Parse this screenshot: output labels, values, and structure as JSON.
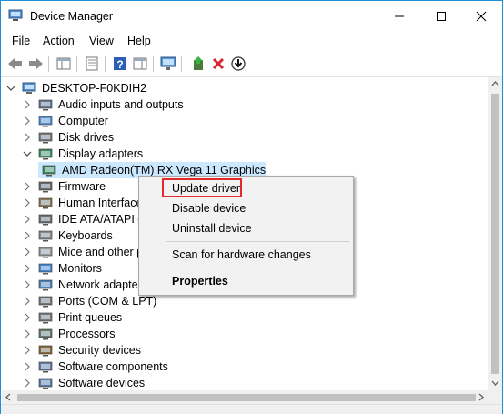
{
  "window": {
    "title": "Device Manager"
  },
  "menu": [
    "File",
    "Action",
    "View",
    "Help"
  ],
  "tree": {
    "root": "DESKTOP-F0KDIH2",
    "items": [
      {
        "label": "Audio inputs and outputs",
        "icon": "speaker-icon",
        "state": "collapsed"
      },
      {
        "label": "Computer",
        "icon": "computer-icon",
        "state": "collapsed"
      },
      {
        "label": "Disk drives",
        "icon": "disk-drive-icon",
        "state": "collapsed"
      },
      {
        "label": "Display adapters",
        "icon": "display-adapter-icon",
        "state": "expanded"
      },
      {
        "label": "AMD Radeon(TM) RX Vega 11 Graphics",
        "icon": "display-adapter-icon",
        "state": "child"
      },
      {
        "label": "Firmware",
        "icon": "firmware-icon",
        "state": "collapsed"
      },
      {
        "label": "Human Interface",
        "icon": "hid-icon",
        "state": "collapsed"
      },
      {
        "label": "IDE ATA/ATAPI co",
        "icon": "ide-controller-icon",
        "state": "collapsed"
      },
      {
        "label": "Keyboards",
        "icon": "keyboard-icon",
        "state": "collapsed"
      },
      {
        "label": "Mice and other p",
        "icon": "mouse-icon",
        "state": "collapsed"
      },
      {
        "label": "Monitors",
        "icon": "monitor-icon",
        "state": "collapsed"
      },
      {
        "label": "Network adapter",
        "icon": "network-adapter-icon",
        "state": "collapsed"
      },
      {
        "label": "Ports (COM & LPT)",
        "icon": "port-icon",
        "state": "collapsed"
      },
      {
        "label": "Print queues",
        "icon": "printer-icon",
        "state": "collapsed"
      },
      {
        "label": "Processors",
        "icon": "processor-icon",
        "state": "collapsed"
      },
      {
        "label": "Security devices",
        "icon": "security-device-icon",
        "state": "collapsed"
      },
      {
        "label": "Software components",
        "icon": "software-component-icon",
        "state": "collapsed"
      },
      {
        "label": "Software devices",
        "icon": "software-device-icon",
        "state": "collapsed"
      }
    ]
  },
  "context_menu": {
    "update_driver": "Update driver",
    "disable_device": "Disable device",
    "uninstall_device": "Uninstall device",
    "scan_hardware": "Scan for hardware changes",
    "properties": "Properties"
  },
  "colors": {
    "selection": "#cce8ff",
    "highlight_border": "#e32a2a",
    "window_border": "#1e90d6"
  }
}
